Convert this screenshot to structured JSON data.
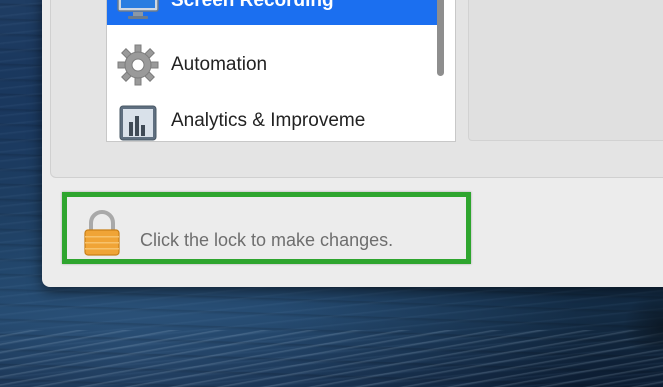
{
  "privacy_list": {
    "items": [
      {
        "label": "Screen Recording",
        "icon": "display-icon",
        "selected": true
      },
      {
        "label": "Automation",
        "icon": "gear-icon",
        "selected": false
      },
      {
        "label": "Analytics & Improveme",
        "icon": "analytics-chart-icon",
        "selected": false
      }
    ]
  },
  "lock": {
    "icon": "lock-icon",
    "text": "Click the lock to make changes."
  },
  "colors": {
    "selection": "#1b6ff0",
    "highlight_frame": "#2ea52e",
    "lock_body": "#f0a436"
  }
}
